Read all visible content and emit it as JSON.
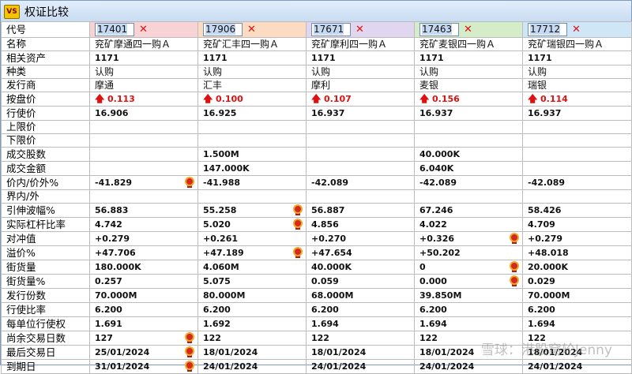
{
  "window": {
    "title": "权证比较",
    "app_icon_text": "VS"
  },
  "columns": [
    {
      "code": "17401",
      "color": "#f8d3d6"
    },
    {
      "code": "17906",
      "color": "#fbdcc2"
    },
    {
      "code": "17671",
      "color": "#e0d6ef"
    },
    {
      "code": "17463",
      "color": "#d5ecc8"
    },
    {
      "code": "17712",
      "color": "#cfe6f7"
    }
  ],
  "header_label": "代号",
  "close_symbol": "✕",
  "rows": [
    {
      "label": "名称",
      "cells": [
        "兖矿摩通四一购Ａ",
        "兖矿汇丰四一购Ａ",
        "兖矿摩利四一购Ａ",
        "兖矿麦银四一购Ａ",
        "兖矿瑞银四一购Ａ"
      ],
      "style": "text"
    },
    {
      "label": "相关资产",
      "cells": [
        "1171",
        "1171",
        "1171",
        "1171",
        "1171"
      ],
      "style": "num"
    },
    {
      "label": "种类",
      "cells": [
        "认购",
        "认购",
        "认购",
        "认购",
        "认购"
      ],
      "style": "text"
    },
    {
      "label": "发行商",
      "cells": [
        "摩通",
        "汇丰",
        "摩利",
        "麦银",
        "瑞银"
      ],
      "style": "text"
    },
    {
      "label": "按盘价",
      "cells": [
        "0.113",
        "0.100",
        "0.107",
        "0.156",
        "0.114"
      ],
      "style": "up"
    },
    {
      "label": "行使价",
      "cells": [
        "16.906",
        "16.925",
        "16.937",
        "16.937",
        "16.937"
      ],
      "style": "num"
    },
    {
      "label": "上限价",
      "cells": [
        "",
        "",
        "",
        "",
        ""
      ],
      "style": "num"
    },
    {
      "label": "下限价",
      "cells": [
        "",
        "",
        "",
        "",
        ""
      ],
      "style": "num"
    },
    {
      "label": "成交股数",
      "cells": [
        "",
        "1.500M",
        "",
        "40.000K",
        ""
      ],
      "style": "num"
    },
    {
      "label": "成交金额",
      "cells": [
        "",
        "147.000K",
        "",
        "6.040K",
        ""
      ],
      "style": "num"
    },
    {
      "label": "价内/价外%",
      "cells": [
        "-41.829",
        "-41.988",
        "-42.089",
        "-42.089",
        "-42.089"
      ],
      "style": "num",
      "badges": [
        0
      ]
    },
    {
      "label": "界内/外",
      "cells": [
        "",
        "",
        "",
        "",
        ""
      ],
      "style": "num"
    },
    {
      "label": "引伸波幅%",
      "cells": [
        "56.883",
        "55.258",
        "56.887",
        "67.246",
        "58.426"
      ],
      "style": "num",
      "badges": [
        1
      ]
    },
    {
      "label": "实际杠杆比率",
      "cells": [
        "4.742",
        "5.020",
        "4.856",
        "4.022",
        "4.709"
      ],
      "style": "num",
      "badges": [
        1
      ]
    },
    {
      "label": "对冲值",
      "cells": [
        "+0.279",
        "+0.261",
        "+0.270",
        "+0.326",
        "+0.279"
      ],
      "style": "num",
      "badges": [
        3
      ]
    },
    {
      "label": "溢价%",
      "cells": [
        "+47.706",
        "+47.189",
        "+47.654",
        "+50.202",
        "+48.018"
      ],
      "style": "num",
      "badges": [
        1
      ]
    },
    {
      "label": "街货量",
      "cells": [
        "180.000K",
        "4.060M",
        "40.000K",
        "0",
        "20.000K"
      ],
      "style": "num",
      "badges": [
        3
      ]
    },
    {
      "label": "街货量%",
      "cells": [
        "0.257",
        "5.075",
        "0.059",
        "0.000",
        "0.029"
      ],
      "style": "num",
      "badges": [
        3
      ]
    },
    {
      "label": "发行份数",
      "cells": [
        "70.000M",
        "80.000M",
        "68.000M",
        "39.850M",
        "70.000M"
      ],
      "style": "num"
    },
    {
      "label": "行使比率",
      "cells": [
        "6.200",
        "6.200",
        "6.200",
        "6.200",
        "6.200"
      ],
      "style": "num"
    },
    {
      "label": "每单位行使权",
      "cells": [
        "1.691",
        "1.692",
        "1.694",
        "1.694",
        "1.694"
      ],
      "style": "num"
    },
    {
      "label": "尚余交易日数",
      "cells": [
        "127",
        "122",
        "122",
        "122",
        "122"
      ],
      "style": "num",
      "badges": [
        0
      ]
    },
    {
      "label": "最后交易日",
      "cells": [
        "25/01/2024",
        "18/01/2024",
        "18/01/2024",
        "18/01/2024",
        "18/01/2024"
      ],
      "style": "num",
      "badges": [
        0
      ]
    },
    {
      "label": "到期日",
      "cells": [
        "31/01/2024",
        "24/01/2024",
        "24/01/2024",
        "24/01/2024",
        "24/01/2024"
      ],
      "style": "num",
      "badges": [
        0
      ]
    }
  ],
  "up_arrow": "🡅",
  "watermark": "雪球：港股窝轮Jenny"
}
